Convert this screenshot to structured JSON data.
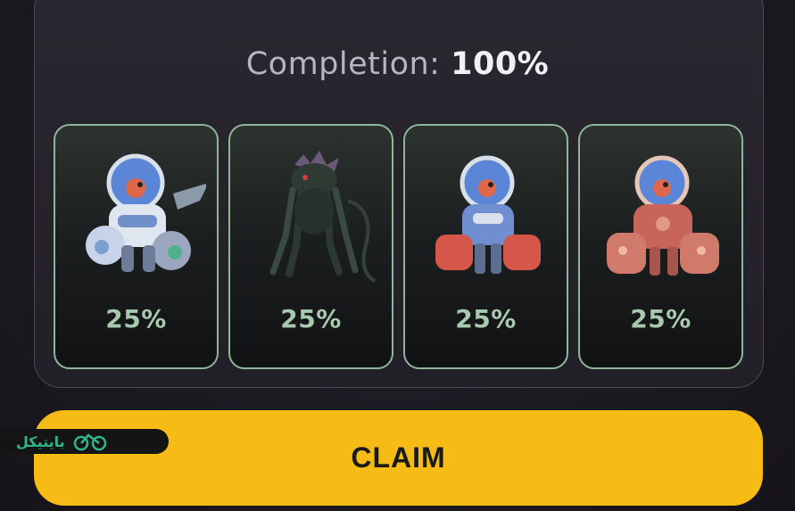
{
  "completion": {
    "label": "Completion:",
    "value": "100%"
  },
  "cards": [
    {
      "percent": "25%",
      "icon": "blue-astronaut-robot-icon"
    },
    {
      "percent": "25%",
      "icon": "dark-creature-icon"
    },
    {
      "percent": "25%",
      "icon": "blue-red-boxer-robot-icon"
    },
    {
      "percent": "25%",
      "icon": "red-armored-robot-icon"
    }
  ],
  "claim_label": "CLAIM",
  "watermark": {
    "text": "بایتیکل",
    "icon": "bicycle-logo-icon"
  },
  "colors": {
    "accent": "#f7bb16",
    "card_border": "#8fb59a",
    "percent_text": "#a9c9ae"
  }
}
